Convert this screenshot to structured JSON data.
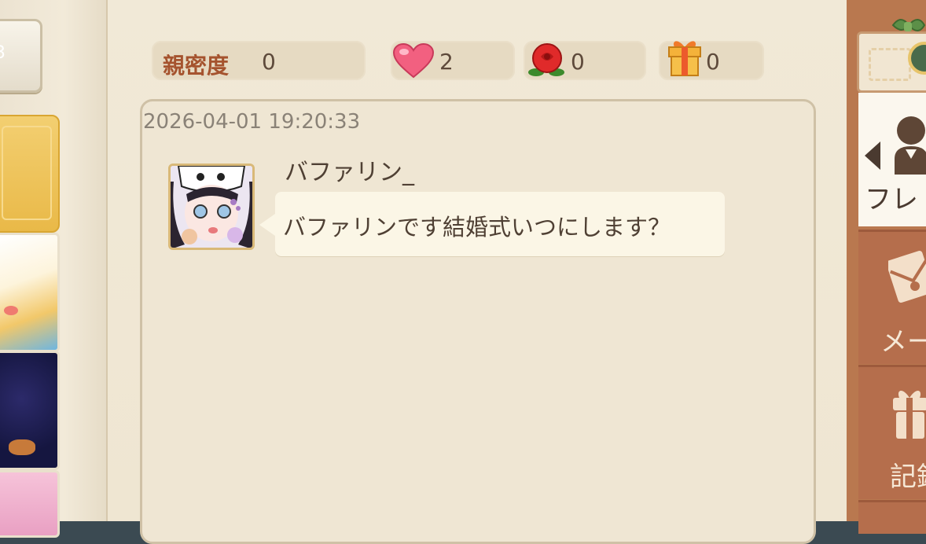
{
  "stats": {
    "intimacy_label": "親密度",
    "intimacy_value": "0",
    "hearts_value": "2",
    "roses_value": "0",
    "gifts_value": "0",
    "icons": [
      "heart-icon",
      "rose-icon",
      "gift-icon"
    ]
  },
  "chat": {
    "timestamp": "2026-04-01 19:20:33",
    "messages": [
      {
        "sender": "バファリン_",
        "text": "バファリンです結婚式いつにします？"
      }
    ]
  },
  "right_nav": {
    "tabs": [
      {
        "label": "フレ",
        "active": true,
        "icon": "person-icon"
      },
      {
        "label": "メー",
        "active": false,
        "icon": "envelope-icon"
      },
      {
        "label": "記録",
        "active": false,
        "icon": "gift-icon"
      }
    ]
  },
  "colors": {
    "accent": "#a5532e",
    "page_bg": "#efe6d3",
    "nav_bg": "#b56e4c",
    "bubble_bg": "#fbf6e6"
  }
}
